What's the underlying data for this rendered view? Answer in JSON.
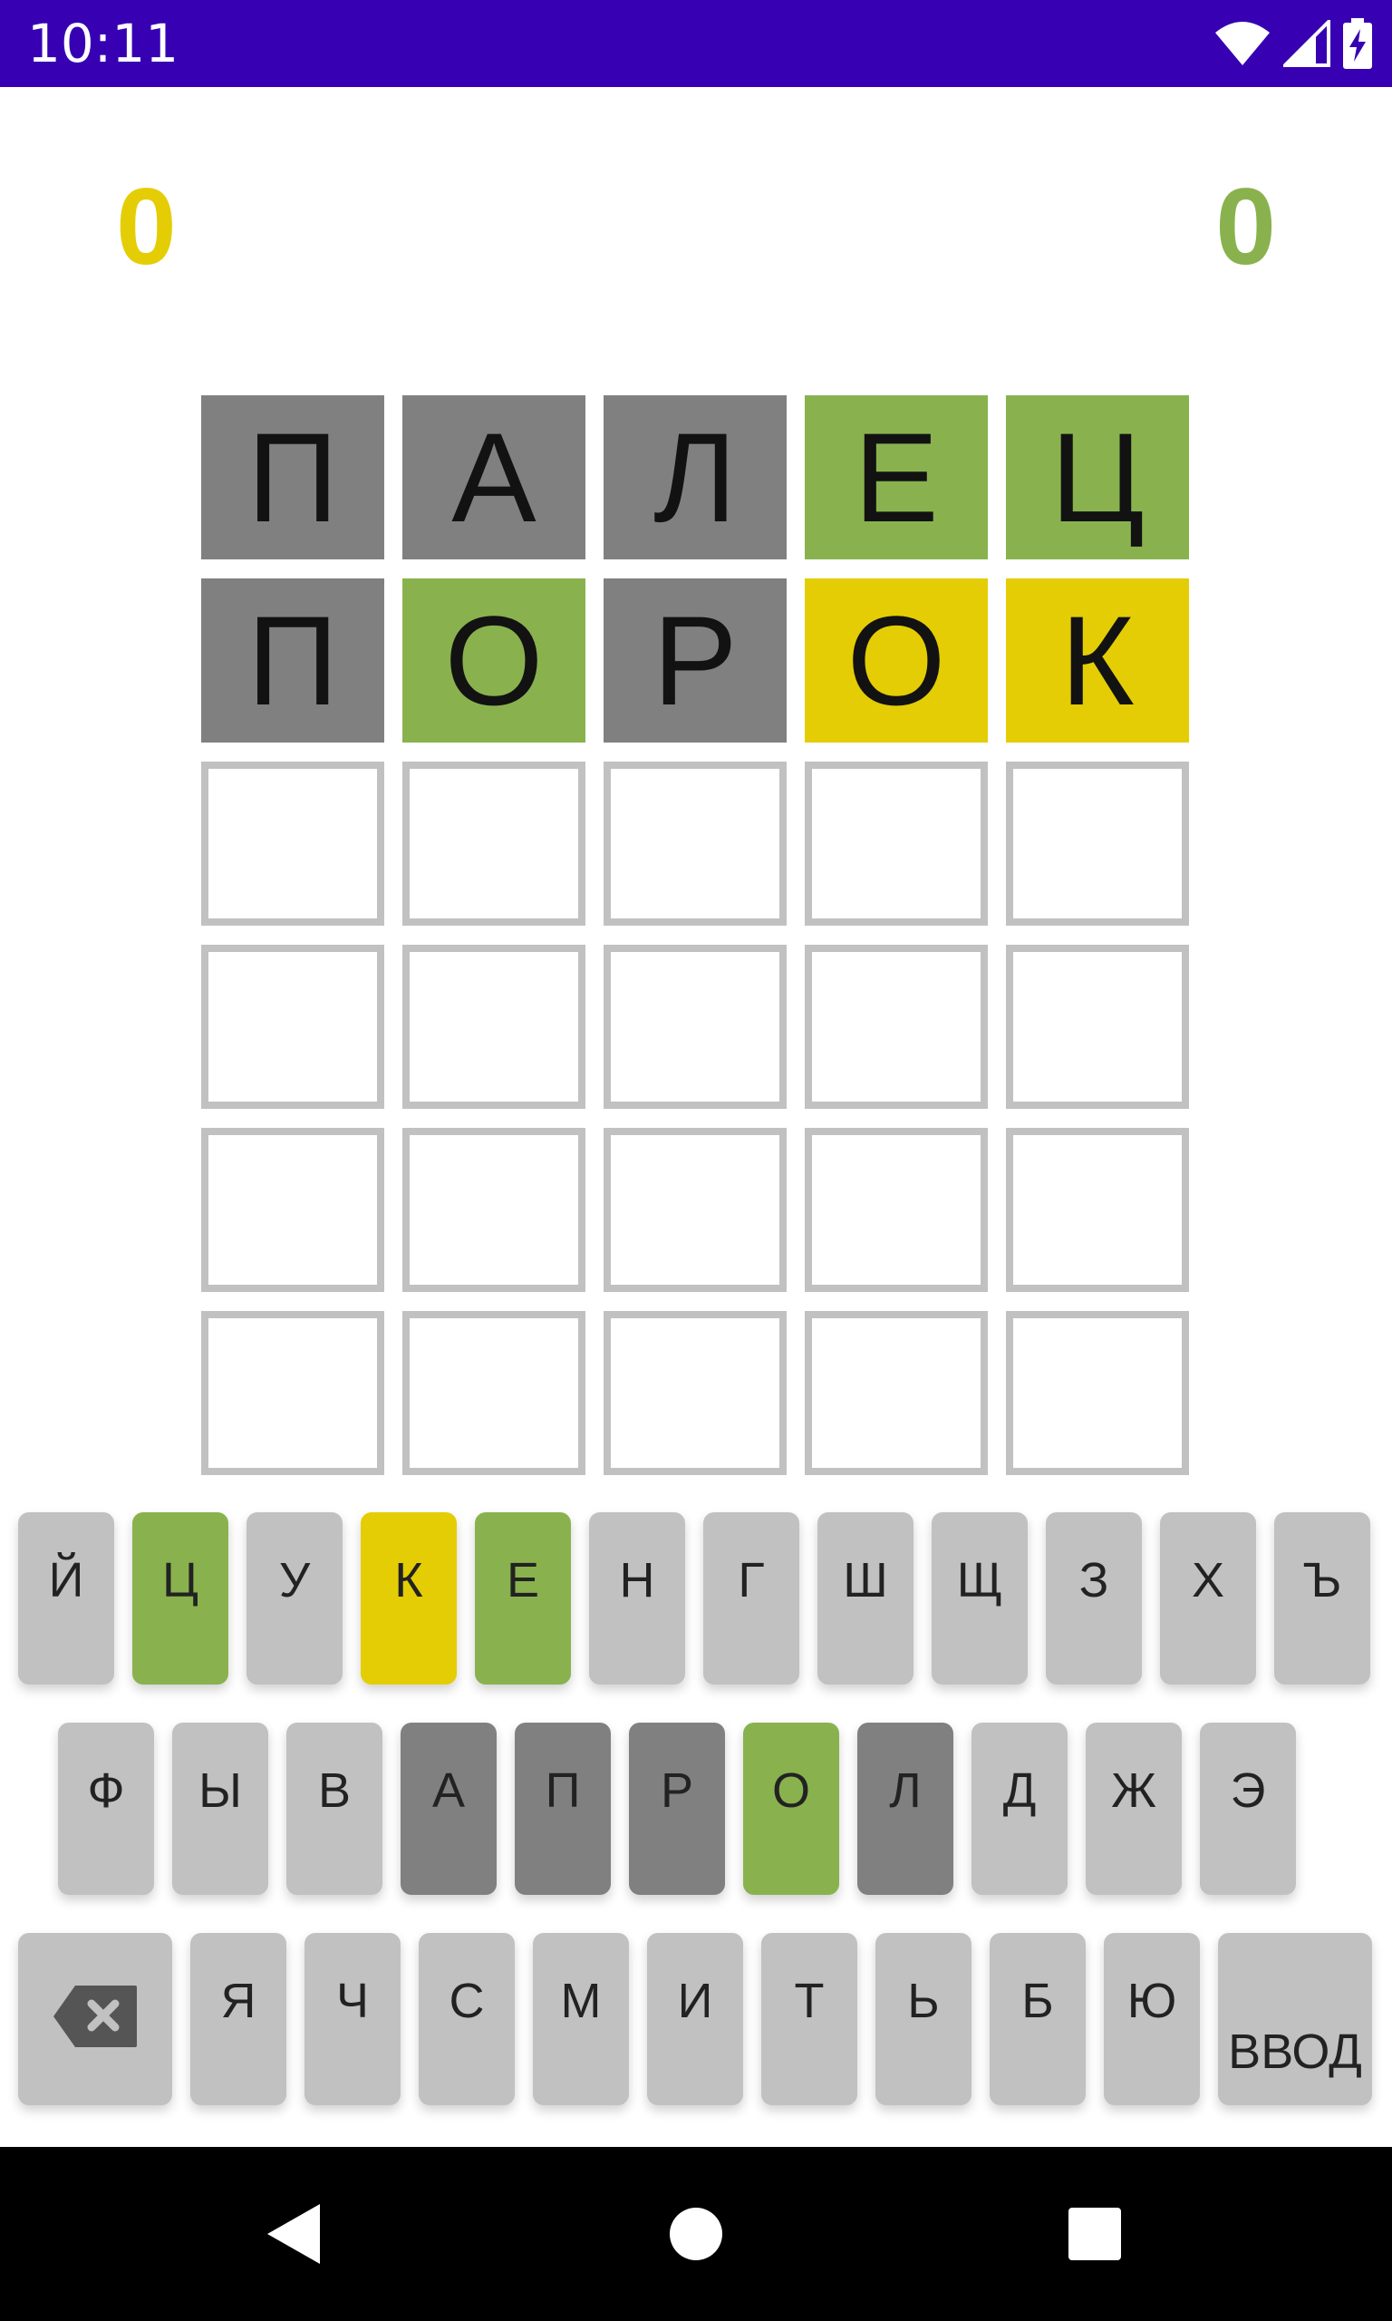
{
  "status_bar": {
    "time": "10:11",
    "icons": [
      "wifi-icon",
      "cell-signal-icon",
      "battery-charging-icon"
    ],
    "background": "#3700b3"
  },
  "scores": {
    "left": {
      "value": "0",
      "color": "#e4cd04"
    },
    "right": {
      "value": "0",
      "color": "#89b24e"
    }
  },
  "colors": {
    "absent": "#808080",
    "correct": "#89b24e",
    "present": "#e4cd04",
    "key_default": "#c1c1c1",
    "empty_border": "#c1c1c1"
  },
  "board": {
    "rows": [
      {
        "cells": [
          {
            "letter": "П",
            "state": "absent"
          },
          {
            "letter": "А",
            "state": "absent"
          },
          {
            "letter": "Л",
            "state": "absent"
          },
          {
            "letter": "Е",
            "state": "correct"
          },
          {
            "letter": "Ц",
            "state": "correct"
          }
        ]
      },
      {
        "cells": [
          {
            "letter": "П",
            "state": "absent"
          },
          {
            "letter": "О",
            "state": "correct"
          },
          {
            "letter": "Р",
            "state": "absent"
          },
          {
            "letter": "О",
            "state": "present"
          },
          {
            "letter": "К",
            "state": "present"
          }
        ]
      },
      {
        "cells": [
          {
            "letter": "",
            "state": "empty"
          },
          {
            "letter": "",
            "state": "empty"
          },
          {
            "letter": "",
            "state": "empty"
          },
          {
            "letter": "",
            "state": "empty"
          },
          {
            "letter": "",
            "state": "empty"
          }
        ]
      },
      {
        "cells": [
          {
            "letter": "",
            "state": "empty"
          },
          {
            "letter": "",
            "state": "empty"
          },
          {
            "letter": "",
            "state": "empty"
          },
          {
            "letter": "",
            "state": "empty"
          },
          {
            "letter": "",
            "state": "empty"
          }
        ]
      },
      {
        "cells": [
          {
            "letter": "",
            "state": "empty"
          },
          {
            "letter": "",
            "state": "empty"
          },
          {
            "letter": "",
            "state": "empty"
          },
          {
            "letter": "",
            "state": "empty"
          },
          {
            "letter": "",
            "state": "empty"
          }
        ]
      },
      {
        "cells": [
          {
            "letter": "",
            "state": "empty"
          },
          {
            "letter": "",
            "state": "empty"
          },
          {
            "letter": "",
            "state": "empty"
          },
          {
            "letter": "",
            "state": "empty"
          },
          {
            "letter": "",
            "state": "empty"
          }
        ]
      }
    ]
  },
  "keyboard": {
    "row1": [
      {
        "label": "Й",
        "state": "default"
      },
      {
        "label": "Ц",
        "state": "correct"
      },
      {
        "label": "У",
        "state": "default"
      },
      {
        "label": "К",
        "state": "present"
      },
      {
        "label": "Е",
        "state": "correct"
      },
      {
        "label": "Н",
        "state": "default"
      },
      {
        "label": "Г",
        "state": "default"
      },
      {
        "label": "Ш",
        "state": "default"
      },
      {
        "label": "Щ",
        "state": "default"
      },
      {
        "label": "З",
        "state": "default"
      },
      {
        "label": "Х",
        "state": "default"
      },
      {
        "label": "Ъ",
        "state": "default"
      }
    ],
    "row2": [
      {
        "label": "Ф",
        "state": "default"
      },
      {
        "label": "Ы",
        "state": "default"
      },
      {
        "label": "В",
        "state": "default"
      },
      {
        "label": "А",
        "state": "absent"
      },
      {
        "label": "П",
        "state": "absent"
      },
      {
        "label": "Р",
        "state": "absent"
      },
      {
        "label": "О",
        "state": "correct"
      },
      {
        "label": "Л",
        "state": "absent"
      },
      {
        "label": "Д",
        "state": "default"
      },
      {
        "label": "Ж",
        "state": "default"
      },
      {
        "label": "Э",
        "state": "default"
      }
    ],
    "row3": [
      {
        "label": "Я",
        "state": "default"
      },
      {
        "label": "Ч",
        "state": "default"
      },
      {
        "label": "С",
        "state": "default"
      },
      {
        "label": "М",
        "state": "default"
      },
      {
        "label": "И",
        "state": "default"
      },
      {
        "label": "Т",
        "state": "default"
      },
      {
        "label": "Ь",
        "state": "default"
      },
      {
        "label": "Б",
        "state": "default"
      },
      {
        "label": "Ю",
        "state": "default"
      }
    ],
    "backspace_icon": "backspace-icon",
    "enter_label": "ВВОД"
  },
  "nav_bar": {
    "icons": [
      "back-triangle-icon",
      "home-circle-icon",
      "recents-square-icon"
    ]
  }
}
